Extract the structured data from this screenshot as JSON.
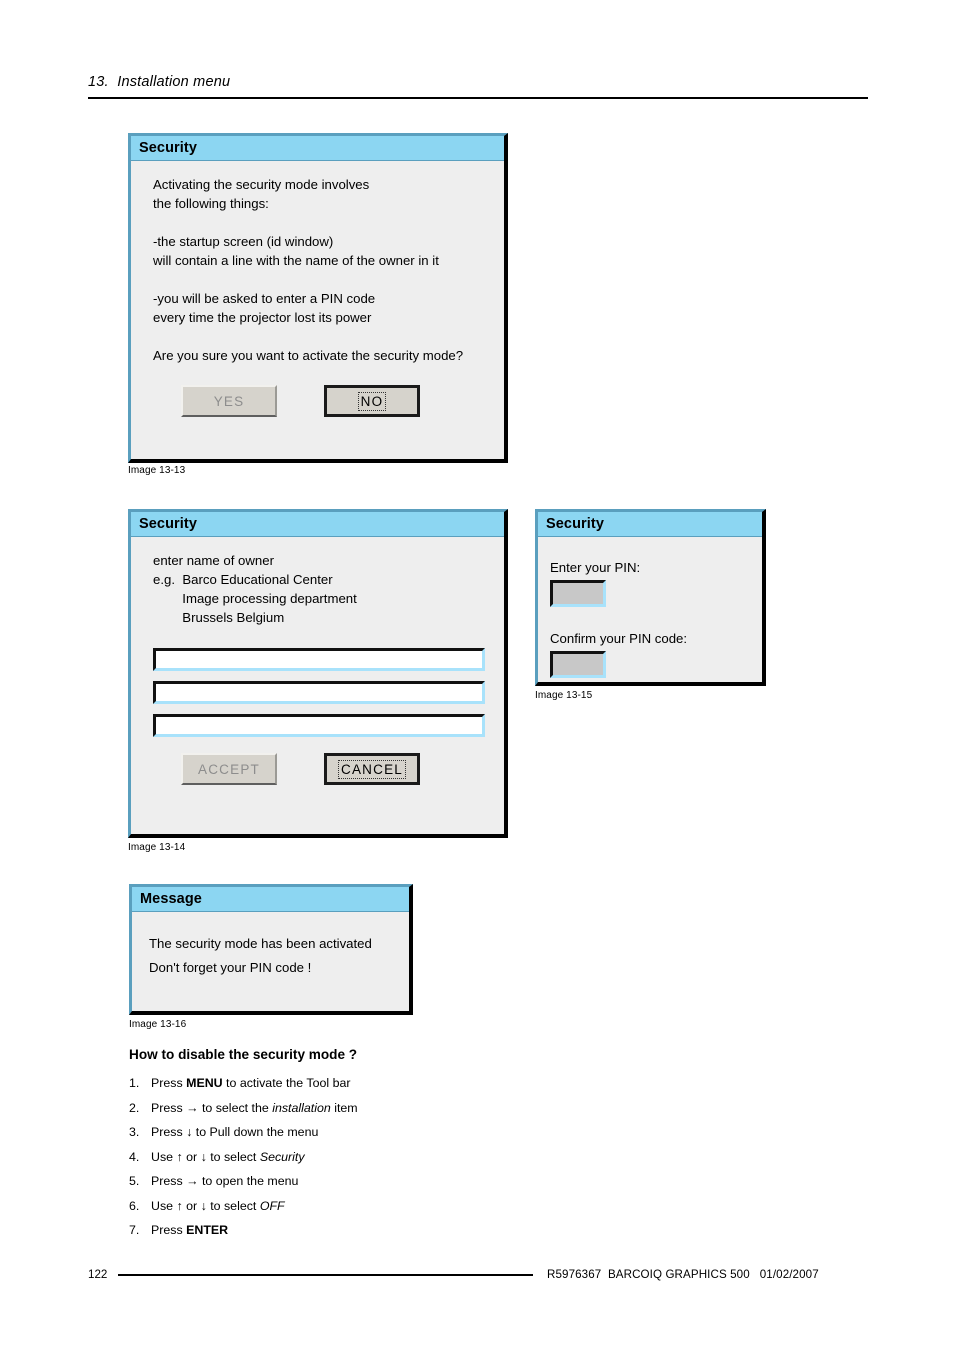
{
  "header": {
    "title": "13.  Installation menu"
  },
  "dialog_confirm": {
    "title": "Security",
    "lines": [
      "Activating the security mode involves",
      "the following things:",
      "",
      "-the startup screen (id window)",
      "will contain a line with the name of the owner in it",
      "",
      "-you will be asked to enter a PIN code",
      "every time the projector lost its power",
      "",
      "Are you sure you want to activate the security mode?"
    ],
    "yes_label": "YES",
    "no_label": "NO",
    "caption": "Image 13-13"
  },
  "dialog_owner": {
    "title": "Security",
    "lines": [
      "enter name of owner",
      "e.g.  Barco Educational Center",
      "        Image processing department",
      "        Brussels Belgium"
    ],
    "field_1_value": "",
    "field_2_value": "",
    "field_3_value": "",
    "accept_label": "ACCEPT",
    "cancel_label": "CANCEL",
    "caption": "Image 13-14"
  },
  "dialog_pin": {
    "title": "Security",
    "enter_pin_label": "Enter your PIN:",
    "enter_pin_value": "",
    "confirm_pin_label": "Confirm your PIN code:",
    "confirm_pin_value": "",
    "caption": "Image 13-15"
  },
  "dialog_message": {
    "title": "Message",
    "lines": [
      "The security mode has been activated",
      "Don't forget your PIN code !"
    ],
    "caption": "Image 13-16"
  },
  "howto": {
    "title": "How to disable the security mode ?",
    "steps": [
      {
        "num": "1.",
        "pre": "Press ",
        "strong": "MENU",
        "post": " to activate the Tool bar",
        "em": ""
      },
      {
        "num": "2.",
        "pre": "Press → to select the ",
        "strong": "",
        "em": "installation",
        "post": " item"
      },
      {
        "num": "3.",
        "pre": "Press ↓ to Pull down the menu",
        "strong": "",
        "em": "",
        "post": ""
      },
      {
        "num": "4.",
        "pre": "Use ↑ or ↓ to select ",
        "strong": "",
        "em": "Security",
        "post": ""
      },
      {
        "num": "5.",
        "pre": "Press → to open the menu",
        "strong": "",
        "em": "",
        "post": ""
      },
      {
        "num": "6.",
        "pre": "Use ↑ or ↓ to select ",
        "strong": "",
        "em": "OFF",
        "post": ""
      },
      {
        "num": "7.",
        "pre": "Press ",
        "strong": "ENTER",
        "em": "",
        "post": ""
      }
    ]
  },
  "footer": {
    "page_number": "122",
    "meta": "R5976367  BARCOIQ GRAPHICS 500   01/02/2007"
  },
  "colors": {
    "titlebar": "#8cd6f2",
    "dialog_border": "#5a9fbe",
    "dialog_bg": "#eeeeee",
    "button_face": "#d6d3cc",
    "pin_field": "#c8c8c8"
  }
}
